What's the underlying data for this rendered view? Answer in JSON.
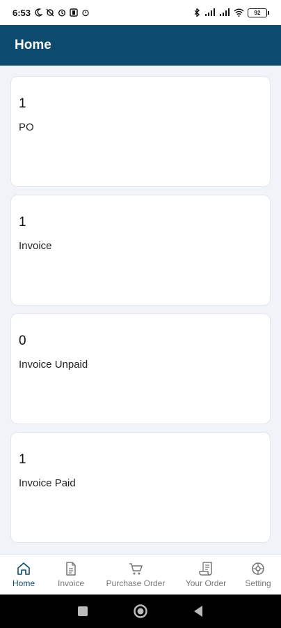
{
  "status_bar": {
    "time": "6:53",
    "battery": "92"
  },
  "app_bar": {
    "title": "Home"
  },
  "cards": [
    {
      "count": "1",
      "label": "PO"
    },
    {
      "count": "1",
      "label": "Invoice"
    },
    {
      "count": "0",
      "label": "Invoice Unpaid"
    },
    {
      "count": "1",
      "label": "Invoice Paid"
    }
  ],
  "bottom_nav": {
    "items": [
      {
        "label": "Home",
        "icon": "home-icon",
        "active": true
      },
      {
        "label": "Invoice",
        "icon": "document-icon"
      },
      {
        "label": "Purchase Order",
        "icon": "cart-icon"
      },
      {
        "label": "Your Order",
        "icon": "receipt-icon"
      },
      {
        "label": "Setting",
        "icon": "gear-icon"
      }
    ]
  },
  "colors": {
    "primary": "#0c4a6e",
    "background": "#f0f3f7",
    "inactive": "#777777"
  }
}
